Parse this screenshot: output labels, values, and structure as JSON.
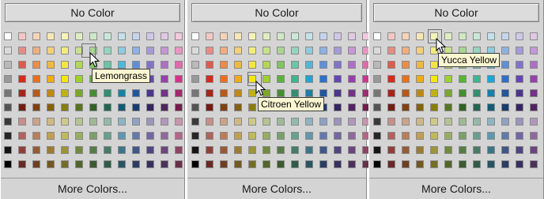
{
  "panels": [
    {
      "no_color_label": "No Color",
      "more_colors_label": "More Colors...",
      "tooltip": "Lemongrass"
    },
    {
      "no_color_label": "No Color",
      "more_colors_label": "More Colors...",
      "tooltip": "Citroen Yellow"
    },
    {
      "no_color_label": "No Color",
      "more_colors_label": "More Colors...",
      "tooltip": "Yucca Yellow"
    }
  ],
  "palette_rows": [
    [
      "#ffffff",
      "#f4c7c4",
      "#f6d3b8",
      "#f7e6b6",
      "#f6f3b7",
      "#dfeec1",
      "#cfe8c4",
      "#c8e8d8",
      "#c3e2ea",
      "#c4d4ee",
      "#cfc8ea",
      "#e0c8e6",
      "#f2c9df"
    ],
    [
      "#dadada",
      "#ea8a84",
      "#f0ae7e",
      "#f3cf79",
      "#f2ec7a",
      "#c7e28a",
      "#a8d692",
      "#96d4bf",
      "#8ccbe0",
      "#8fb0e2",
      "#a69ad8",
      "#c696d6",
      "#e995c3"
    ],
    [
      "#b9b9b9",
      "#e05a4e",
      "#ec8c48",
      "#f0b93f",
      "#f4e543",
      "#b2d853",
      "#80c460",
      "#6cc4a7",
      "#4eb8db",
      "#5f8fd7",
      "#8372c9",
      "#ae6fc6",
      "#e06aa9"
    ],
    [
      "#989898",
      "#d9291c",
      "#e9701b",
      "#f0ac14",
      "#f5e60e",
      "#9ed12c",
      "#58b338",
      "#3eb58f",
      "#1ea5d8",
      "#2d6fc9",
      "#6347b3",
      "#9740ad",
      "#d2348c"
    ],
    [
      "#767676",
      "#a7241b",
      "#b55a1b",
      "#bd8816",
      "#c0b215",
      "#7ea72a",
      "#468d31",
      "#318f71",
      "#1a80a7",
      "#22569d",
      "#4b368a",
      "#743288",
      "#a22a6d"
    ],
    [
      "#545454",
      "#761b14",
      "#7f4014",
      "#85600f",
      "#877d0f",
      "#58751f",
      "#326224",
      "#236551",
      "#135b77",
      "#183c6f",
      "#342661",
      "#512460",
      "#721e4d"
    ],
    [
      "#3a3a3a",
      "#c58f8a",
      "#caa388",
      "#cdb886",
      "#cdca89",
      "#b3c392",
      "#9fb996",
      "#93b9aa",
      "#8db4c2",
      "#8fa2c3",
      "#9c94bd",
      "#b196bb",
      "#c795ad"
    ],
    [
      "#262626",
      "#b0625d",
      "#b97e58",
      "#bf9e55",
      "#bfb958",
      "#97ad62",
      "#7aa06a",
      "#69a08c",
      "#5f98ad",
      "#6379ab",
      "#7466a3",
      "#9068a0",
      "#b16788"
    ],
    [
      "#141414",
      "#8f3f3a",
      "#965a35",
      "#9b7a33",
      "#9b9535",
      "#728a3e",
      "#567c46",
      "#467b67",
      "#3c7489",
      "#3f5687",
      "#514480",
      "#6c457e",
      "#8d4464"
    ],
    [
      "#000000",
      "#692925",
      "#6e3f22",
      "#735822",
      "#736e24",
      "#52652a",
      "#3c5a30",
      "#305a4a",
      "#285464",
      "#2a3e63",
      "#38305e",
      "#4d315d",
      "#673049"
    ]
  ]
}
